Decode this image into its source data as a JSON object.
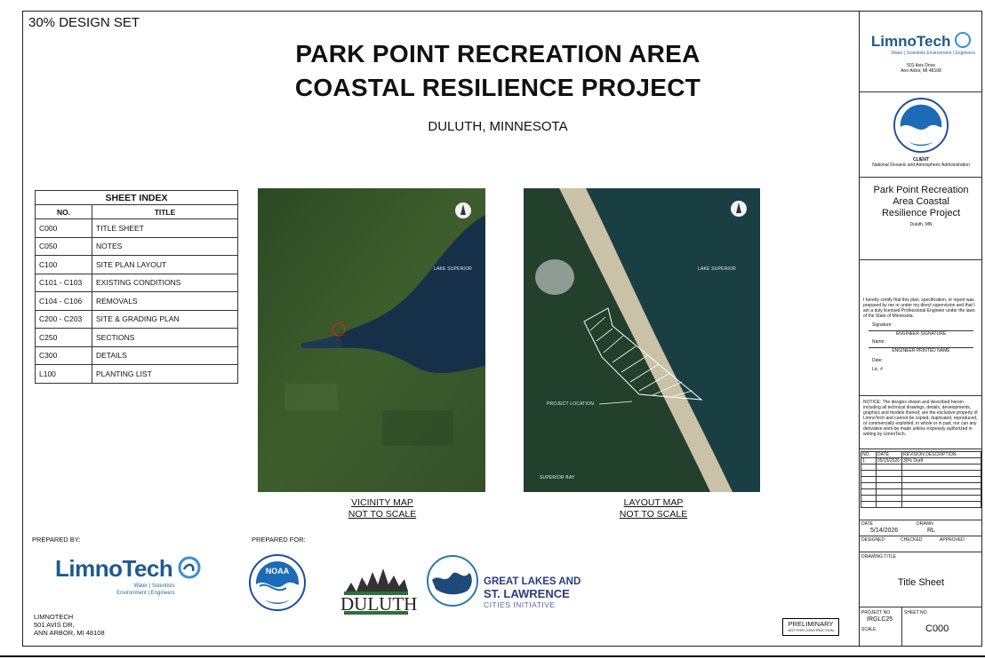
{
  "header": {
    "design_set": "30% DESIGN SET",
    "title_line1": "PARK POINT RECREATION AREA",
    "title_line2": "COASTAL RESILIENCE PROJECT",
    "location": "DULUTH, MINNESOTA"
  },
  "sheet_index": {
    "title": "SHEET INDEX",
    "col_no": "NO.",
    "col_title": "TITLE",
    "rows": [
      {
        "no": "C000",
        "title": "TITLE SHEET"
      },
      {
        "no": "C050",
        "title": "NOTES"
      },
      {
        "no": "C100",
        "title": "SITE PLAN LAYOUT"
      },
      {
        "no": "C101 - C103",
        "title": "EXISTING CONDITIONS"
      },
      {
        "no": "C104 - C106",
        "title": "REMOVALS"
      },
      {
        "no": "C200 - C203",
        "title": "SITE & GRADING PLAN"
      },
      {
        "no": "C250",
        "title": "SECTIONS"
      },
      {
        "no": "C300",
        "title": "DETAILS"
      },
      {
        "no": "L100",
        "title": "PLANTING LIST"
      }
    ]
  },
  "maps": {
    "vicinity": {
      "label1": "VICINITY MAP",
      "label2": "NOT TO SCALE",
      "lake": "LAKE SUPERIOR"
    },
    "layout": {
      "label1": "LAYOUT MAP",
      "label2": "NOT TO SCALE",
      "lake": "LAKE SUPERIOR",
      "project": "PROJECT LOCATION",
      "bay": "SUPERIOR BAY"
    }
  },
  "prepared_by": {
    "label": "PREPARED BY:",
    "logo_text": "LimnoTech",
    "logo_sub1": "Water | Scientists",
    "logo_sub2": "Environment | Engineers",
    "addr1": "LIMNOTECH",
    "addr2": "501 AVIS DR,",
    "addr3": "ANN ARBOR, MI 48108"
  },
  "prepared_for": {
    "label": "PREPARED FOR:",
    "noaa": "NOAA",
    "duluth": "DULUTH",
    "glsl1": "GREAT LAKES AND",
    "glsl2": "ST. LAWRENCE",
    "glsl3": "CITIES INITIATIVE"
  },
  "preliminary": {
    "line1": "PRELIMINARY",
    "line2": "NOT FOR CONSTRUCTION"
  },
  "title_block": {
    "firm": "LimnoTech",
    "firm_sub": "Water | Scientists  Environment | Engineers",
    "firm_addr1": "501 Avis Drive",
    "firm_addr2": "Ann Arbor, MI 48108",
    "client_label": "CLIENT",
    "client_name": "National Oceanic and Atmospheric Administration",
    "project_name": "Park Point Recreation Area Coastal Resilience Project",
    "project_loc": "Duluth, MN",
    "cert": "I hereby certify that this plan, specification, or report was prepared by me or under my direct supervision and that I am a duly licensed Professional Engineer under the laws of the State of Minnesota.",
    "signature": "Signature:",
    "eng_sig": "ENGINEER SIGNATURE",
    "name": "Name:",
    "eng_name": "ENGINEER PRINTED NAME",
    "date_lbl": "Date:",
    "lic": "Lic. #",
    "notice": "NOTICE: The designs shown and described herein including all technical drawings, details, developments, graphics and models thereof, are the exclusive property of LimnoTech and cannot be copied, duplicated, reproduced, or commercially exploited, in whole or in part, nor can any derivative work be made unless expressly authorized in writing by LimnoTech.",
    "rev_no": "NO.",
    "rev_date": "DATE",
    "rev_desc": "REVISION DESCRIPTION",
    "rev1_no": "1",
    "rev1_date": "05/15/2026",
    "rev1_desc": "30% Draft",
    "date": "DATE",
    "date_val": "5/14/2026",
    "drawn": "DRAWN",
    "drawn_val": "RL",
    "designed": "DESIGNED",
    "checked": "CHECKED",
    "approved": "APPROVED",
    "drawing_title_lbl": "DRAWING TITLE",
    "drawing_title": "Title Sheet",
    "project_no_lbl": "PROJECT NO",
    "project_no": "IRGLC25",
    "sheet_no_lbl": "SHEET NO.",
    "sheet_no": "C000",
    "scale_lbl": "SCALE"
  }
}
